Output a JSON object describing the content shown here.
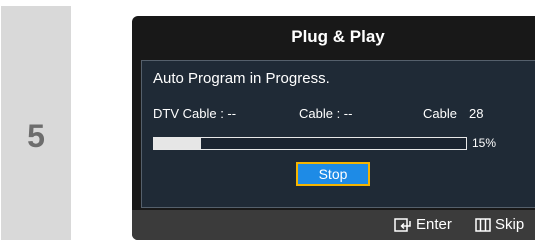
{
  "step": {
    "number": "5"
  },
  "dialog": {
    "title": "Plug & Play",
    "status": "Auto Program in Progress.",
    "dtv_cable": "DTV Cable : --",
    "cable": "Cable : --",
    "cable_channel_label": "Cable",
    "cable_channel_value": "28",
    "progress": {
      "percent": 15,
      "label": "15%"
    },
    "stop_label": "Stop",
    "accent_color": "#1e8be6",
    "focus_color": "#f5b400"
  },
  "footer": {
    "enter": {
      "icon": "enter-icon",
      "label": "Enter"
    },
    "skip": {
      "icon": "skip-icon",
      "label": "Skip"
    }
  }
}
